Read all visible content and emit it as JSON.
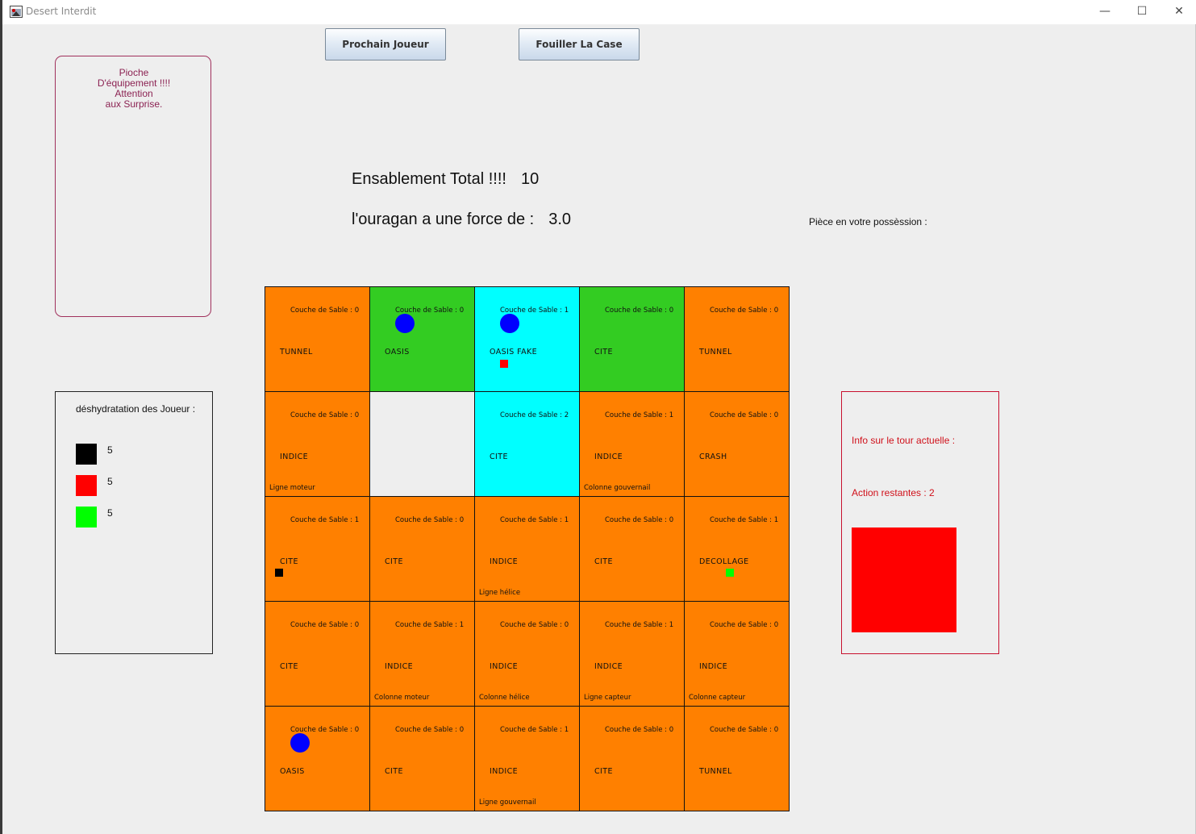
{
  "window": {
    "title": "Desert Interdit",
    "minimize_glyph": "—",
    "maximize_glyph": "☐",
    "close_glyph": "✕"
  },
  "toolbar": {
    "next_player_label": "Prochain Joueur",
    "search_tile_label": "Fouiller La Case"
  },
  "equipment_card": {
    "lines": [
      "Pioche",
      "D'équipement !!!!",
      "Attention",
      "aux Surprise."
    ],
    "color": "#8b2252"
  },
  "dehydration": {
    "title": "déshydratation des Joueur :",
    "players": [
      {
        "color": "#000000",
        "value": "5"
      },
      {
        "color": "#ff0000",
        "value": "5"
      },
      {
        "color": "#00ff00",
        "value": "5"
      }
    ]
  },
  "status": {
    "sand_label": "Ensablement Total !!!!",
    "sand_value": "10",
    "storm_label": "l'ouragan a une force de :",
    "storm_value": "3.0",
    "possession_label": "Pièce en votre possèssion :"
  },
  "turn_info": {
    "title": "Info sur le tour actuelle :",
    "actions": "Action restantes : 2",
    "current_player_color": "#ff0000"
  },
  "colors": {
    "desert": "#ff8000",
    "green": "#33cc22",
    "water": "#00ffff",
    "empty": "#eeeeee",
    "water_token": "#0000ff"
  },
  "board": {
    "tiles": [
      {
        "bg": "desert",
        "sand": "Couche de Sable : 0",
        "type": "TUNNEL",
        "piece": "",
        "water": false,
        "player": ""
      },
      {
        "bg": "green",
        "sand": "Couche de Sable : 0",
        "type": "OASIS",
        "piece": "",
        "water": true,
        "player": ""
      },
      {
        "bg": "water",
        "sand": "Couche de Sable : 1",
        "type": "OASIS FAKE",
        "piece": "",
        "water": true,
        "player": "#ff0000"
      },
      {
        "bg": "green",
        "sand": "Couche de Sable : 0",
        "type": "CITE",
        "piece": "",
        "water": false,
        "player": ""
      },
      {
        "bg": "desert",
        "sand": "Couche de Sable : 0",
        "type": "TUNNEL",
        "piece": "",
        "water": false,
        "player": ""
      },
      {
        "bg": "desert",
        "sand": "Couche de Sable : 0",
        "type": "INDICE",
        "piece": "Ligne moteur",
        "water": false,
        "player": ""
      },
      {
        "bg": "empty",
        "sand": "",
        "type": "",
        "piece": "",
        "water": false,
        "player": ""
      },
      {
        "bg": "water",
        "sand": "Couche de Sable : 2",
        "type": "CITE",
        "piece": "",
        "water": false,
        "player": ""
      },
      {
        "bg": "desert",
        "sand": "Couche de Sable : 1",
        "type": "INDICE",
        "piece": "Colonne gouvernail",
        "water": false,
        "player": ""
      },
      {
        "bg": "desert",
        "sand": "Couche de Sable : 0",
        "type": "CRASH",
        "piece": "",
        "water": false,
        "player": ""
      },
      {
        "bg": "desert",
        "sand": "Couche de Sable : 1",
        "type": "CITE",
        "piece": "",
        "water": false,
        "player": "#000000"
      },
      {
        "bg": "desert",
        "sand": "Couche de Sable : 0",
        "type": "CITE",
        "piece": "",
        "water": false,
        "player": ""
      },
      {
        "bg": "desert",
        "sand": "Couche de Sable : 1",
        "type": "INDICE",
        "piece": "Ligne hélice",
        "water": false,
        "player": ""
      },
      {
        "bg": "desert",
        "sand": "Couche de Sable : 0",
        "type": "CITE",
        "piece": "",
        "water": false,
        "player": ""
      },
      {
        "bg": "desert",
        "sand": "Couche de Sable : 1",
        "type": "DECOLLAGE",
        "piece": "",
        "water": false,
        "player": "#00ff00"
      },
      {
        "bg": "desert",
        "sand": "Couche de Sable : 0",
        "type": "CITE",
        "piece": "",
        "water": false,
        "player": ""
      },
      {
        "bg": "desert",
        "sand": "Couche de Sable : 1",
        "type": "INDICE",
        "piece": "Colonne moteur",
        "water": false,
        "player": ""
      },
      {
        "bg": "desert",
        "sand": "Couche de Sable : 0",
        "type": "INDICE",
        "piece": "Colonne hélice",
        "water": false,
        "player": ""
      },
      {
        "bg": "desert",
        "sand": "Couche de Sable : 1",
        "type": "INDICE",
        "piece": "Ligne capteur",
        "water": false,
        "player": ""
      },
      {
        "bg": "desert",
        "sand": "Couche de Sable : 0",
        "type": "INDICE",
        "piece": "Colonne capteur",
        "water": false,
        "player": ""
      },
      {
        "bg": "desert",
        "sand": "Couche de Sable : 0",
        "type": "OASIS",
        "piece": "",
        "water": true,
        "player": ""
      },
      {
        "bg": "desert",
        "sand": "Couche de Sable : 0",
        "type": "CITE",
        "piece": "",
        "water": false,
        "player": ""
      },
      {
        "bg": "desert",
        "sand": "Couche de Sable : 1",
        "type": "INDICE",
        "piece": "Ligne gouvernail",
        "water": false,
        "player": ""
      },
      {
        "bg": "desert",
        "sand": "Couche de Sable : 0",
        "type": "CITE",
        "piece": "",
        "water": false,
        "player": ""
      },
      {
        "bg": "desert",
        "sand": "Couche de Sable : 0",
        "type": "TUNNEL",
        "piece": "",
        "water": false,
        "player": ""
      }
    ]
  }
}
